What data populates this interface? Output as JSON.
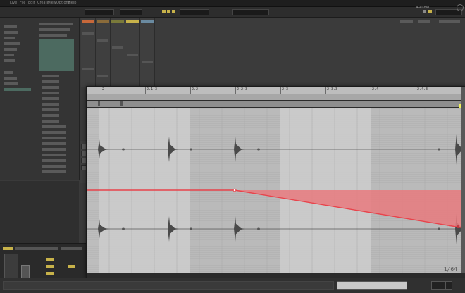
{
  "menubar": {
    "items": [
      "Live",
      "File",
      "Edit",
      "Create",
      "View",
      "Options",
      "Help"
    ]
  },
  "clip_view": {
    "ruler_labels": [
      "2",
      "2.1.3",
      "2.2",
      "2.2.3",
      "2.3",
      "2.3.3",
      "2.4",
      "2.4.3"
    ],
    "quantize_label": "1/64",
    "envelope_color": "#e8434b",
    "envelope_fill": "#e77a7e"
  },
  "status": {
    "label": "A-Audio"
  },
  "colors": {
    "background": "#3a3a3a",
    "grid_light": "#c7c7c7",
    "grid_dark": "#b2b2b2",
    "accent": "#c7b24a"
  }
}
